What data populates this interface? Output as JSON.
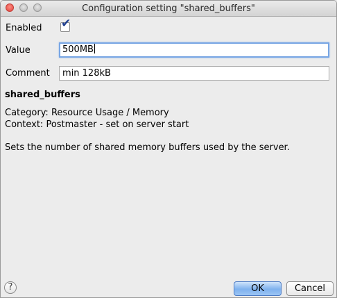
{
  "window": {
    "title": "Configuration setting \"shared_buffers\""
  },
  "form": {
    "enabled_label": "Enabled",
    "enabled_checked": true,
    "value_label": "Value",
    "value": "500MB",
    "comment_label": "Comment",
    "comment": "min 128kB"
  },
  "description": {
    "name": "shared_buffers",
    "category": "Category: Resource Usage / Memory",
    "context": "Context: Postmaster - set on server start",
    "summary": "Sets the number of shared memory buffers used by the server."
  },
  "buttons": {
    "help": "?",
    "ok": "OK",
    "cancel": "Cancel"
  },
  "icons": {
    "checkmark": "checkmark-icon",
    "help": "question-icon"
  }
}
